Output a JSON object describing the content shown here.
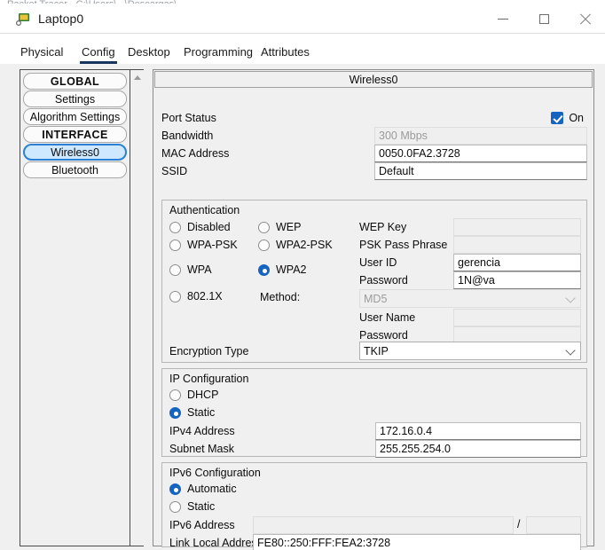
{
  "window": {
    "title": "Laptop0",
    "icon": "packet-tracer-laptop-icon",
    "ghost_text": "Packet Tracer - C:\\Users\\...\\Descargas\\...",
    "minimize_label": "─",
    "maximize_label": "□",
    "close_label": "✕"
  },
  "tabs": [
    {
      "label": "Physical",
      "active": false
    },
    {
      "label": "Config",
      "active": true
    },
    {
      "label": "Desktop",
      "active": false
    },
    {
      "label": "Programming",
      "active": false
    },
    {
      "label": "Attributes",
      "active": false
    }
  ],
  "sidebar": {
    "items": [
      {
        "label": "GLOBAL",
        "type": "header",
        "selected": false
      },
      {
        "label": "Settings",
        "type": "item",
        "selected": false
      },
      {
        "label": "Algorithm Settings",
        "type": "item",
        "selected": false
      },
      {
        "label": "INTERFACE",
        "type": "header",
        "selected": false
      },
      {
        "label": "Wireless0",
        "type": "item",
        "selected": true
      },
      {
        "label": "Bluetooth",
        "type": "item",
        "selected": false
      }
    ],
    "scroll_up_icon": "scroll-up-arrow-icon"
  },
  "panel": {
    "header": "Wireless0",
    "port_status": {
      "label": "Port Status",
      "checked_label": "On",
      "checked": true
    },
    "bandwidth": {
      "label": "Bandwidth",
      "value": "300 Mbps",
      "disabled": true
    },
    "mac_address": {
      "label": "MAC Address",
      "value": "0050.0FA2.3728",
      "disabled": false
    },
    "ssid": {
      "label": "SSID",
      "value": "Default",
      "disabled": false
    }
  },
  "authentication": {
    "title": "Authentication",
    "options": [
      {
        "label": "Disabled",
        "selected": false
      },
      {
        "label": "WEP",
        "selected": false
      },
      {
        "label": "WPA-PSK",
        "selected": false
      },
      {
        "label": "WPA2-PSK",
        "selected": false
      },
      {
        "label": "WPA",
        "selected": false
      },
      {
        "label": "WPA2",
        "selected": true
      },
      {
        "label": "802.1X",
        "selected": false
      }
    ],
    "method_label": "Method:",
    "fields": {
      "wep_key": {
        "label": "WEP Key",
        "value": "",
        "disabled": true
      },
      "psk_pass_phrase": {
        "label": "PSK Pass Phrase",
        "value": "",
        "disabled": true
      },
      "user_id": {
        "label": "User ID",
        "value": "gerencia",
        "disabled": false
      },
      "password": {
        "label": "Password",
        "value": "1N@va",
        "disabled": false
      },
      "method_select": {
        "value": "MD5",
        "disabled": true
      },
      "user_name": {
        "label": "User Name",
        "value": "",
        "disabled": true
      },
      "password2": {
        "label": "Password",
        "value": "",
        "disabled": true
      }
    },
    "encryption_type": {
      "label": "Encryption Type",
      "value": "TKIP",
      "disabled": false
    }
  },
  "ip_configuration": {
    "title": "IP Configuration",
    "options": [
      {
        "label": "DHCP",
        "selected": false
      },
      {
        "label": "Static",
        "selected": true
      }
    ],
    "ipv4_address": {
      "label": "IPv4 Address",
      "value": "172.16.0.4"
    },
    "subnet_mask": {
      "label": "Subnet Mask",
      "value": "255.255.254.0"
    }
  },
  "ipv6_configuration": {
    "title": "IPv6 Configuration",
    "options": [
      {
        "label": "Automatic",
        "selected": true
      },
      {
        "label": "Static",
        "selected": false
      }
    ],
    "ipv6_address": {
      "label": "IPv6 Address",
      "value": "",
      "prefix": "",
      "separator": "/"
    },
    "link_local_address": {
      "label": "Link Local Address:",
      "value": "FE80::250:FFF:FEA2:3728"
    }
  },
  "colors": {
    "accent": "#1565c0",
    "tab_underline": "#17365d",
    "selection_bg": "#cde8ff",
    "selection_border": "#2b7fd4"
  }
}
